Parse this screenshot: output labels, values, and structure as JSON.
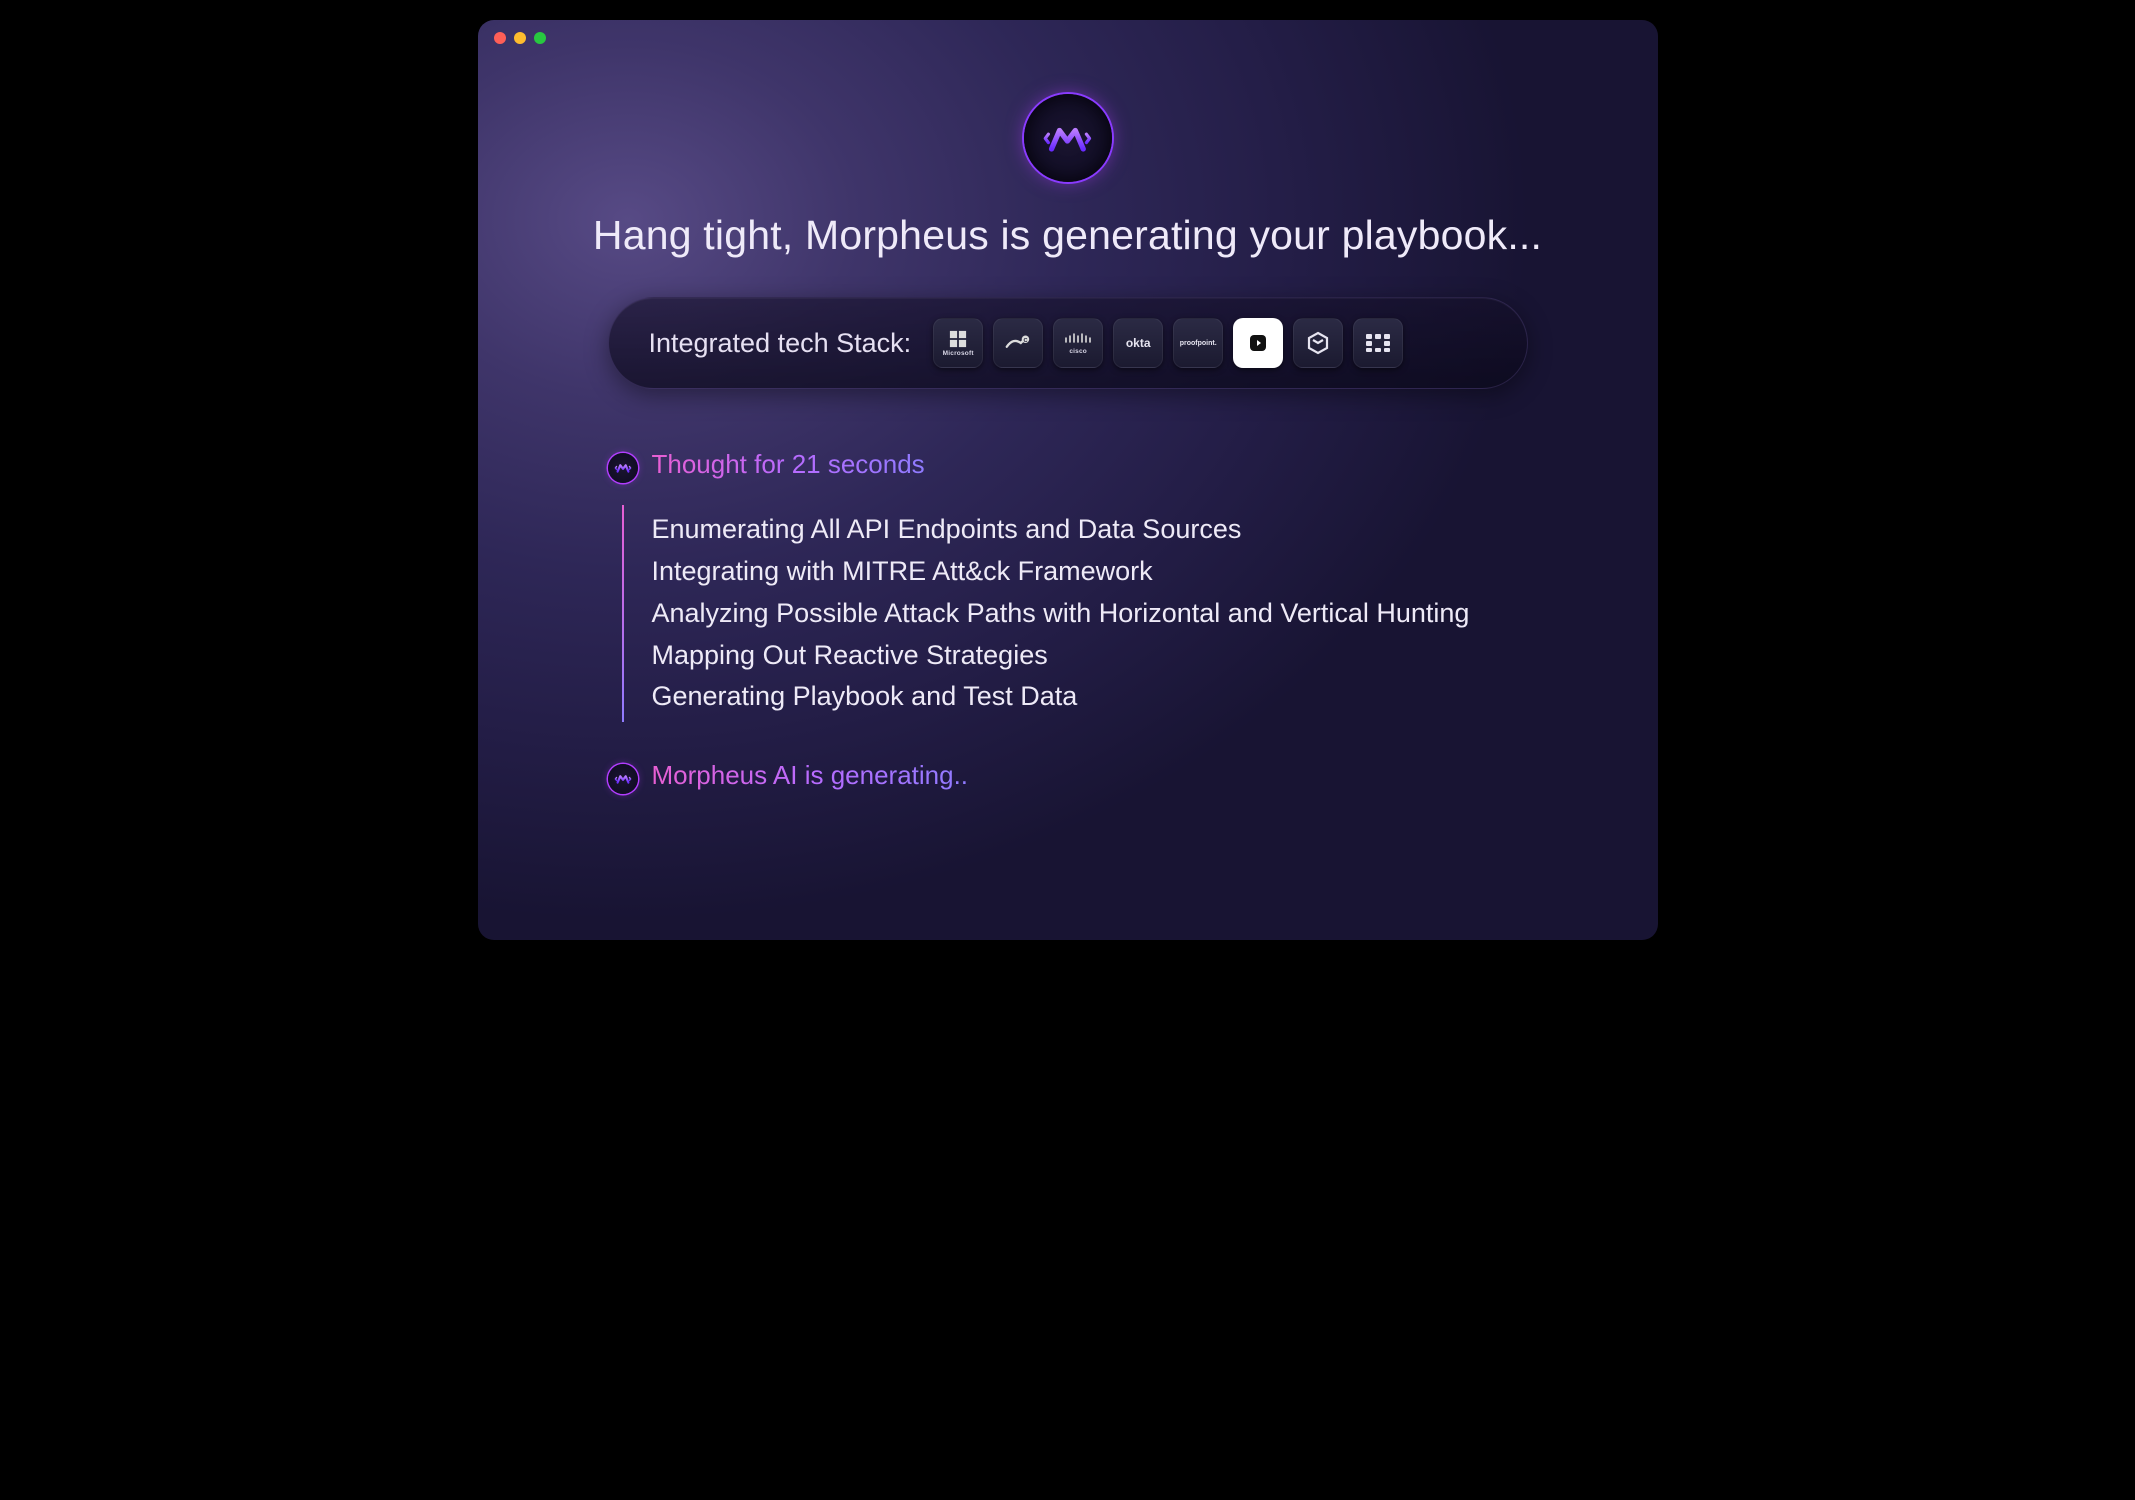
{
  "headline": "Hang tight, Morpheus is generating your playbook...",
  "stack": {
    "label": "Integrated tech Stack:",
    "items": [
      {
        "id": "microsoft",
        "name": "Microsoft"
      },
      {
        "id": "cisco-umbrella",
        "name": ""
      },
      {
        "id": "cisco",
        "name": "cisco"
      },
      {
        "id": "okta",
        "name": "okta"
      },
      {
        "id": "proofpoint",
        "name": "proofpoint."
      },
      {
        "id": "play",
        "name": ""
      },
      {
        "id": "stack",
        "name": ""
      },
      {
        "id": "fortinet",
        "name": ""
      }
    ]
  },
  "thought": {
    "label": "Thought for 21 seconds",
    "steps": [
      "Enumerating All API Endpoints and Data Sources",
      "Integrating with MITRE Att&ck Framework",
      "Analyzing Possible Attack Paths with Horizontal and Vertical Hunting",
      "Mapping Out Reactive Strategies",
      "Generating Playbook and Test Data"
    ]
  },
  "status": "Morpheus AI is generating..",
  "colors": {
    "grad_start": "#e85fd3",
    "grad_end": "#8f7bff"
  }
}
